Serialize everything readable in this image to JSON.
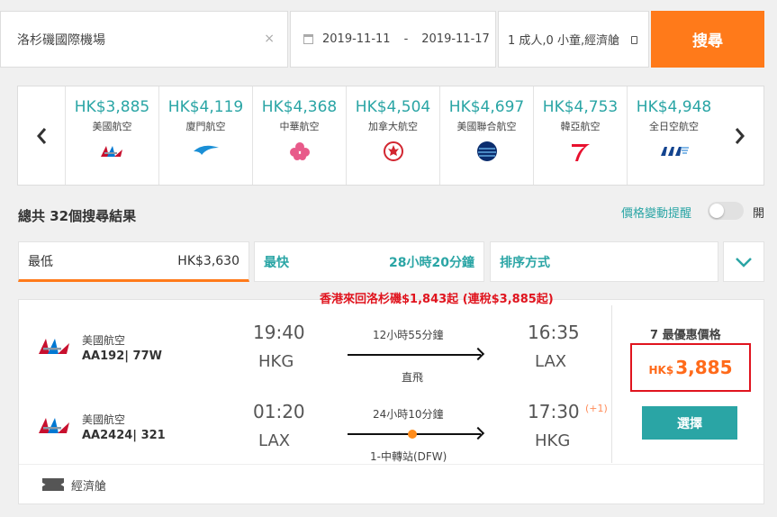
{
  "search": {
    "origin": "洛杉磯國際機場",
    "clear_symbol": "×",
    "depart_date": "2019-11-11",
    "date_separator": "-",
    "return_date": "2019-11-17",
    "passengers": "1 成人,0 小童,經濟艙",
    "search_label": "搜尋"
  },
  "carousel": {
    "prev_symbol": "‹",
    "next_symbol": "›",
    "airlines": [
      {
        "price": "HK$3,885",
        "name": "美國航空",
        "logo": "american-airlines-logo"
      },
      {
        "price": "HK$4,119",
        "name": "廈門航空",
        "logo": "xiamen-air-logo"
      },
      {
        "price": "HK$4,368",
        "name": "中華航空",
        "logo": "china-airlines-logo"
      },
      {
        "price": "HK$4,504",
        "name": "加拿大航空",
        "logo": "air-canada-logo"
      },
      {
        "price": "HK$4,697",
        "name": "美國聯合航空",
        "logo": "united-airlines-logo"
      },
      {
        "price": "HK$4,753",
        "name": "韓亞航空",
        "logo": "asiana-logo"
      },
      {
        "price": "HK$4,948",
        "name": "全日空航空",
        "logo": "ana-logo"
      }
    ]
  },
  "results": {
    "count_text": "總共 32個搜尋結果",
    "price_alert_label": "價格變動提醒",
    "toggle_state": "開"
  },
  "sort": {
    "cheapest_label": "最低",
    "cheapest_value": "HK$3,630",
    "fastest_label": "最快",
    "fastest_value": "28小時20分鐘",
    "sort_label": "排序方式"
  },
  "annotation": "香港來回洛杉磯$1,843起 (連稅$3,885起)",
  "result": {
    "legs": [
      {
        "airline": "美國航空",
        "flight": "AA192| 77W",
        "dep_time": "19:40",
        "dep_code": "HKG",
        "duration": "12小時55分鐘",
        "stops": "直飛",
        "arr_time": "16:35",
        "arr_code": "LAX",
        "plus_day": ""
      },
      {
        "airline": "美國航空",
        "flight": "AA2424| 321",
        "dep_time": "01:20",
        "dep_code": "LAX",
        "duration": "24小時10分鐘",
        "stops": "1-中轉站(DFW)",
        "arr_time": "17:30",
        "arr_code": "HKG",
        "plus_day": "(+1)"
      }
    ],
    "price_hint": "7 最優惠價格",
    "price_currency": "HK$",
    "price_amount": "3,885",
    "select_label": "選擇",
    "cabin_label": "經濟艙"
  },
  "colors": {
    "accent_orange": "#ff7a1a",
    "teal": "#2aa5a5",
    "highlight_red": "#e0141e"
  }
}
